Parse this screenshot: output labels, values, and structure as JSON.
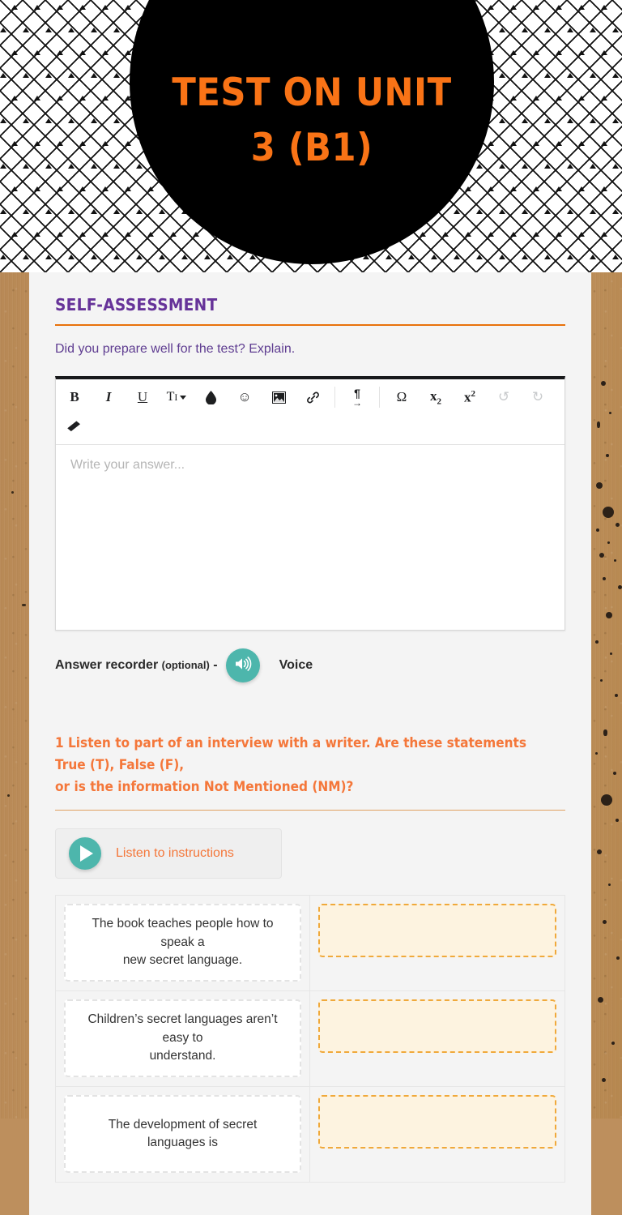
{
  "banner": {
    "title": "Test on Unit\n3 (B1)",
    "circle_color": "#000000",
    "title_color": "#f97316"
  },
  "self_assessment": {
    "section_title": "Self-assessment",
    "prompt": "Did you prepare well for the test? Explain.",
    "accent_rule_color": "#e8710a",
    "title_color": "#663399"
  },
  "editor": {
    "placeholder": "Write your answer...",
    "value": "",
    "toolbar": [
      {
        "name": "bold-icon",
        "glyph": "B",
        "style": "bold-serif",
        "dim": false
      },
      {
        "name": "italic-icon",
        "glyph": "I",
        "style": "italic-serif",
        "dim": false
      },
      {
        "name": "underline-icon",
        "glyph": "U",
        "style": "underline-serif",
        "dim": false
      },
      {
        "name": "font-size-icon",
        "glyph": "TI",
        "style": "serif-caret",
        "dim": false
      },
      {
        "name": "text-color-icon",
        "glyph": "⬤",
        "style": "droplet",
        "dim": false
      },
      {
        "name": "emoji-icon",
        "glyph": "☺",
        "style": "plain",
        "dim": false
      },
      {
        "name": "insert-image-icon",
        "glyph": "🖼",
        "style": "image",
        "dim": false
      },
      {
        "name": "insert-link-icon",
        "glyph": "🔗",
        "style": "link",
        "dim": false
      },
      {
        "name": "separator",
        "glyph": "",
        "style": "sep",
        "dim": false
      },
      {
        "name": "text-direction-icon",
        "glyph": "¶",
        "style": "direction",
        "dim": false
      },
      {
        "name": "separator",
        "glyph": "",
        "style": "sep",
        "dim": false
      },
      {
        "name": "special-character-icon",
        "glyph": "Ω",
        "style": "serif",
        "dim": false
      },
      {
        "name": "subscript-icon",
        "glyph": "x",
        "style": "subscript",
        "dim": false
      },
      {
        "name": "superscript-icon",
        "glyph": "x",
        "style": "superscript",
        "dim": false
      },
      {
        "name": "undo-icon",
        "glyph": "↺",
        "style": "plain",
        "dim": true
      },
      {
        "name": "redo-icon",
        "glyph": "↻",
        "style": "plain",
        "dim": true
      },
      {
        "name": "clear-formatting-icon",
        "glyph": "◤",
        "style": "eraser",
        "dim": false
      }
    ]
  },
  "recorder": {
    "label": "Answer recorder",
    "optional": "(optional)",
    "dash": "-",
    "voice_label": "Voice",
    "button_color": "#4db6ac"
  },
  "question": {
    "instruction": "1 Listen to part of an interview with a writer. Are these statements True (T), False (F),\nor is the information Not Mentioned (NM)?",
    "instruction_color": "#f4773a",
    "listen_label": "Listen to instructions",
    "rows": [
      {
        "statement": "The book teaches people how to speak a\nnew secret language.",
        "answer": ""
      },
      {
        "statement": "Children’s secret languages aren’t easy to\nunderstand.",
        "answer": ""
      },
      {
        "statement": "The development of secret\nlanguages is",
        "answer": ""
      }
    ]
  }
}
